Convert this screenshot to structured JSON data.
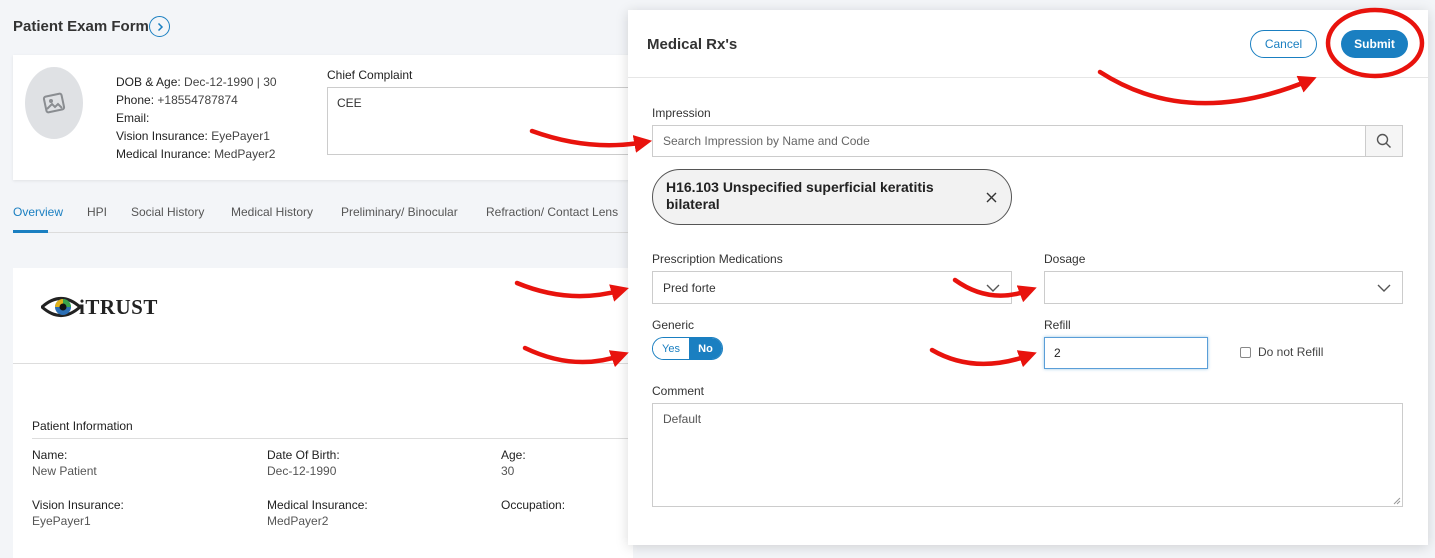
{
  "page": {
    "title": "Patient Exam Form"
  },
  "patient_card": {
    "dob_label": "DOB & Age:",
    "dob_value": "Dec-12-1990 | 30",
    "phone_label": "Phone:",
    "phone_value": "+18554787874",
    "email_label": "Email:",
    "vision_label": "Vision Insurance:",
    "vision_value": "EyePayer1",
    "medical_label": "Medical Inurance:",
    "medical_value": "MedPayer2",
    "cc_label": "Chief Complaint",
    "cc_value": "CEE"
  },
  "tabs": [
    {
      "label": "Overview",
      "active": true
    },
    {
      "label": "HPI"
    },
    {
      "label": "Social History"
    },
    {
      "label": "Medical History"
    },
    {
      "label": "Preliminary/ Binocular"
    },
    {
      "label": "Refraction/ Contact Lens"
    }
  ],
  "document": {
    "logo_text": "iTRUST",
    "section_title": "Patient Information",
    "fields": {
      "name_label": "Name:",
      "name_value": "New Patient",
      "dob_label": "Date Of Birth:",
      "dob_value": "Dec-12-1990",
      "age_label": "Age:",
      "age_value": "30",
      "vision_label": "Vision Insurance:",
      "vision_value": "EyePayer1",
      "medical_label": "Medical Insurance:",
      "medical_value": "MedPayer2",
      "occupation_label": "Occupation:"
    }
  },
  "modal": {
    "title": "Medical Rx's",
    "cancel_label": "Cancel",
    "submit_label": "Submit",
    "impression_label": "Impression",
    "impression_placeholder": "Search Impression by Name and Code",
    "impression_chip": "H16.103 Unspecified superficial keratitis bilateral",
    "rx_label": "Prescription Medications",
    "rx_value": "Pred forte",
    "dosage_label": "Dosage",
    "dosage_value": "",
    "generic_label": "Generic",
    "generic_yes": "Yes",
    "generic_no": "No",
    "generic_selected": "No",
    "refill_label": "Refill",
    "refill_value": "2",
    "do_not_refill_label": "Do not Refill",
    "do_not_refill_checked": false,
    "comment_label": "Comment",
    "comment_value": "Default"
  },
  "colors": {
    "accent": "#1a7fc1",
    "annotation": "#e8130d"
  },
  "icons": {
    "title_button": "chevron-right-icon",
    "avatar": "image-placeholder-icon",
    "search": "search-icon",
    "chip_close": "close-icon",
    "select_chevron": "chevron-down-icon"
  }
}
